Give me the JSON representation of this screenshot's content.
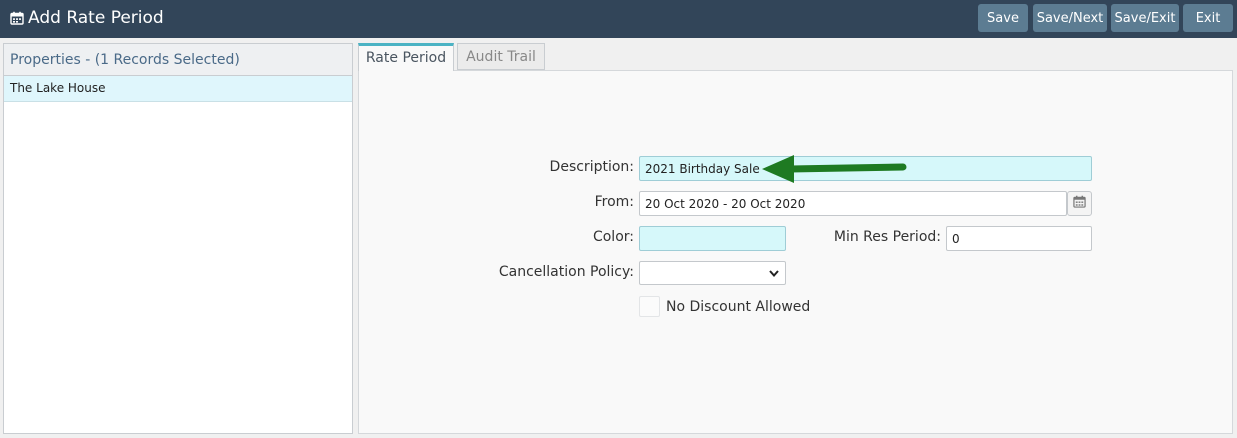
{
  "header": {
    "title": "Add Rate Period",
    "buttons": {
      "save": "Save",
      "save_next": "Save/Next",
      "save_exit": "Save/Exit",
      "exit": "Exit"
    }
  },
  "sidebar": {
    "title": "Properties - (1 Records Selected)",
    "items": [
      {
        "label": "The Lake House"
      }
    ]
  },
  "tabs": [
    {
      "label": "Rate Period",
      "active": true
    },
    {
      "label": "Audit Trail",
      "active": false
    }
  ],
  "form": {
    "description": {
      "label": "Description:",
      "value": "2021 Birthday Sale"
    },
    "from": {
      "label": "From:",
      "value": "20 Oct 2020 - 20 Oct 2020"
    },
    "color": {
      "label": "Color:",
      "value": ""
    },
    "min_res_period": {
      "label": "Min Res Period:",
      "value": "0"
    },
    "cancellation_policy": {
      "label": "Cancellation Policy:",
      "value": ""
    },
    "no_discount": {
      "label": "No Discount Allowed",
      "checked": false
    }
  },
  "colors": {
    "topbar": "#324559",
    "button": "#5c7c92",
    "highlight_field": "#d6f8fa",
    "selected_row": "#dff6fc",
    "active_tab_accent": "#4bb3c4",
    "annotation_arrow": "#1e7a22"
  },
  "icons": {
    "title": "calendar-icon",
    "date_picker": "calendar-icon",
    "select": "chevron-down-icon",
    "annotation": "arrow-left-annotation"
  }
}
